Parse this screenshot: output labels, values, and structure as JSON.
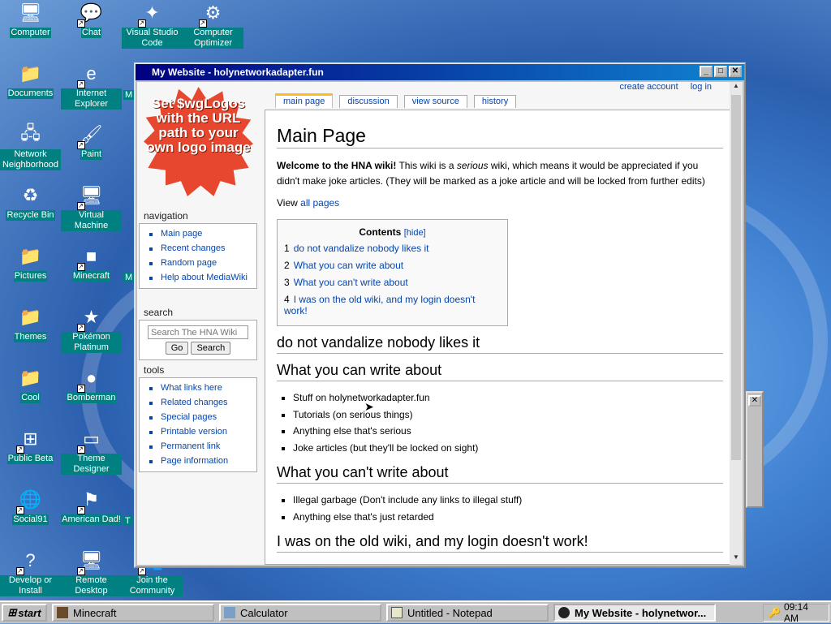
{
  "desktop": {
    "icons": [
      {
        "label": "Computer",
        "glyph": "🖥"
      },
      {
        "label": "Chat",
        "glyph": "💬"
      },
      {
        "label": "Visual Studio Code",
        "glyph": "✦"
      },
      {
        "label": "Computer Optimizer",
        "glyph": "⚙"
      },
      {
        "label": "Documents",
        "glyph": "📁"
      },
      {
        "label": "Internet Explorer",
        "glyph": "e"
      },
      {
        "label": "Network Neighborhood",
        "glyph": "🖧"
      },
      {
        "label": "Paint",
        "glyph": "🖌"
      },
      {
        "label": "Recycle Bin",
        "glyph": "♻"
      },
      {
        "label": "Virtual Machine",
        "glyph": "🖥"
      },
      {
        "label": "Pictures",
        "glyph": "📁"
      },
      {
        "label": "Minecraft",
        "glyph": "■"
      },
      {
        "label": "Themes",
        "glyph": "📁"
      },
      {
        "label": "Pokémon Platinum",
        "glyph": "★"
      },
      {
        "label": "Cool",
        "glyph": "📁"
      },
      {
        "label": "Bomberman",
        "glyph": "●"
      },
      {
        "label": "Public Beta",
        "glyph": "⊞"
      },
      {
        "label": "Theme Designer",
        "glyph": "▭"
      },
      {
        "label": "Social91",
        "glyph": "🌐"
      },
      {
        "label": "American Dad!",
        "glyph": "⚑"
      },
      {
        "label": "Develop or Install",
        "glyph": "?"
      },
      {
        "label": "Remote Desktop",
        "glyph": "🖥"
      },
      {
        "label": "Join the Community",
        "glyph": "👥"
      }
    ],
    "partial_labels": [
      "M",
      "M",
      "T"
    ]
  },
  "window": {
    "title": "My Website - holynetworkadapter.fun",
    "buttons": {
      "min": "_",
      "max": "□",
      "close": "✕"
    }
  },
  "wiki": {
    "logo_text": "Set $wgLogos with the URL path to your own logo image",
    "personal": {
      "create_account": "create account",
      "log_in": "log in"
    },
    "tabs": [
      "main page",
      "discussion",
      "view source",
      "history"
    ],
    "navigation": {
      "heading": "navigation",
      "items": [
        "Main page",
        "Recent changes",
        "Random page",
        "Help about MediaWiki"
      ]
    },
    "search": {
      "heading": "search",
      "placeholder": "Search The HNA Wiki",
      "go": "Go",
      "search": "Search"
    },
    "tools": {
      "heading": "tools",
      "items": [
        "What links here",
        "Related changes",
        "Special pages",
        "Printable version",
        "Permanent link",
        "Page information"
      ]
    },
    "article": {
      "title": "Main Page",
      "intro_bold": "Welcome to the HNA wiki!",
      "intro_a": " This wiki is a ",
      "intro_em": "serious",
      "intro_b": " wiki, which means it would be appreciated if you didn't make joke articles. (They will be marked as a joke article and will be locked from further edits)",
      "view_prefix": "View ",
      "view_link": "all pages",
      "toc": {
        "title": "Contents",
        "hide": "[hide]",
        "entries": [
          {
            "num": "1",
            "text": "do not vandalize nobody likes it"
          },
          {
            "num": "2",
            "text": "What you can write about"
          },
          {
            "num": "3",
            "text": "What you can't write about"
          },
          {
            "num": "4",
            "text": "I was on the old wiki, and my login doesn't work!"
          }
        ]
      },
      "sections": [
        {
          "heading": "do not vandalize nobody likes it",
          "items": []
        },
        {
          "heading": "What you can write about",
          "items": [
            "Stuff on holynetworkadapter.fun",
            "Tutorials (on serious things)",
            "Anything else that's serious",
            "Joke articles (but they'll be locked on sight)"
          ]
        },
        {
          "heading": "What you can't write about",
          "items": [
            "Illegal garbage (Don't include any links to illegal stuff)",
            "Anything else that's just retarded"
          ]
        },
        {
          "heading": "I was on the old wiki, and my login doesn't work!",
          "items": []
        }
      ]
    }
  },
  "taskbar": {
    "start": "start",
    "tasks": [
      {
        "label": "Minecraft",
        "active": false
      },
      {
        "label": "Calculator",
        "active": false
      },
      {
        "label": "Untitled - Notepad",
        "active": false
      },
      {
        "label": "My Website - holynetwor...",
        "active": true
      }
    ],
    "clock": "09:14 AM"
  }
}
